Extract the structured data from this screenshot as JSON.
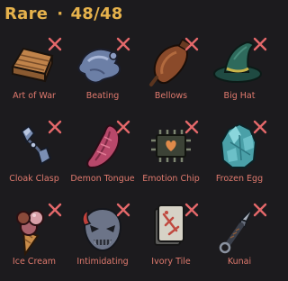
{
  "header": {
    "rarity": "Rare",
    "separator": "·",
    "count": "48/48"
  },
  "colors": {
    "header": "#e6b24c",
    "label": "#e07a6e",
    "cross": "#e4686a",
    "background": "#1c1b1e"
  },
  "items": [
    {
      "label": "Art of War",
      "icon": "book-stack-icon"
    },
    {
      "label": "Beating",
      "icon": "ghost-hand-icon"
    },
    {
      "label": "Bellows",
      "icon": "bellows-icon"
    },
    {
      "label": "Big Hat",
      "icon": "witch-hat-icon"
    },
    {
      "label": "Cloak Clasp",
      "icon": "clasp-icon"
    },
    {
      "label": "Demon Tongue",
      "icon": "tongue-icon"
    },
    {
      "label": "Emotion Chip",
      "icon": "chip-icon"
    },
    {
      "label": "Frozen Egg",
      "icon": "frozen-egg-icon"
    },
    {
      "label": "Ice Cream",
      "icon": "ice-cream-icon"
    },
    {
      "label": "Intimidating",
      "icon": "mask-icon"
    },
    {
      "label": "Ivory Tile",
      "icon": "ivory-tile-icon"
    },
    {
      "label": "Kunai",
      "icon": "kunai-icon"
    }
  ]
}
